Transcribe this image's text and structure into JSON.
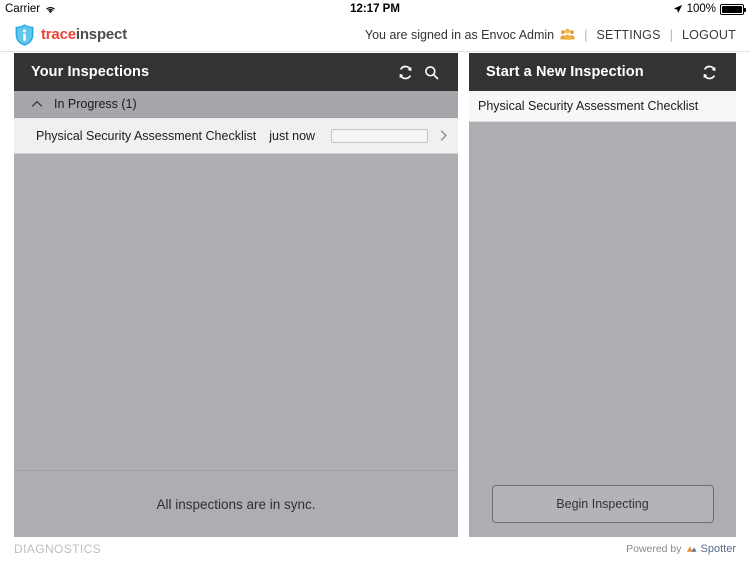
{
  "status_bar": {
    "carrier": "Carrier",
    "wifi_icon": "wifi-icon",
    "time": "12:17 PM",
    "location_icon": "location-arrow-icon",
    "battery_percent": "100%",
    "battery_icon": "battery-full-icon"
  },
  "app_header": {
    "logo_icon": "shield-logo-icon",
    "logo_text_primary": "trace",
    "logo_text_secondary": "inspect",
    "signed_in_text": "You are signed in as Envoc Admin",
    "people_icon": "people-group-icon",
    "separator": "|",
    "settings_label": "SETTINGS",
    "logout_label": "LOGOUT"
  },
  "left_panel": {
    "title": "Your Inspections",
    "refresh_icon": "refresh-icon",
    "search_icon": "search-icon",
    "group": {
      "collapse_icon": "chevron-up-icon",
      "label": "In Progress (1)"
    },
    "inspections": [
      {
        "name": "Physical Security Assessment Checklist",
        "time": "just now",
        "progress_percent": 4,
        "chevron_icon": "chevron-right-icon"
      }
    ],
    "sync_status": "All inspections are in sync."
  },
  "right_panel": {
    "title": "Start a New Inspection",
    "refresh_icon": "refresh-icon",
    "templates": [
      {
        "name": "Physical Security Assessment Checklist"
      }
    ],
    "begin_button_label": "Begin Inspecting"
  },
  "bottom_bar": {
    "diagnostics_label": "DIAGNOSTICS",
    "powered_by_label": "Powered by",
    "spotter_icon": "spotter-logo-icon",
    "spotter_label": "Spotter"
  },
  "colors": {
    "panel_header_bg": "#333333",
    "panel_body_bg": "#aeaeb2",
    "brand_red": "#ef4136",
    "brand_dark": "#4d4d4d",
    "shield_blue": "#29abe2",
    "progress_blue": "#29abe2",
    "accent_orange": "#f5a623",
    "spotter_blue": "#5a6b8c"
  }
}
